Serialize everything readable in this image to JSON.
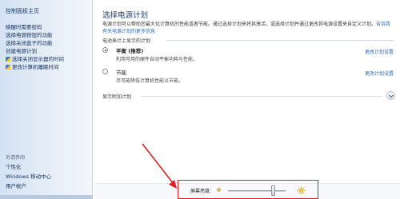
{
  "sidebar": {
    "home": "控制面板主页",
    "links": [
      "唤醒时需要密码",
      "选择电源按钮的功能",
      "选择关闭盖子的功能",
      "创建电源计划",
      "选择关闭显示器的时间",
      "更改计算机睡眠时间"
    ],
    "see_also_title": "另请参阅",
    "see_also": [
      "个性化",
      "Windows 移动中心",
      "用户帐户"
    ]
  },
  "main": {
    "title": "选择电源计划",
    "description": "电源计划可以帮助您最大化计算机的性能或者节能。通过选择计划来将其激活，或选择计划并通过更改其电源设置来自定义计划。",
    "description_link": "告诉我有关电源计划的更多信息",
    "section_label": "电池表计上显示的计划",
    "plans": [
      {
        "name": "平衡 (推荐)",
        "desc": "利用可用的硬件自动平衡功耗与性能。",
        "link": "更改计划设置",
        "selected": true
      },
      {
        "name": "节能",
        "desc": "尽可能降低计算机性能以节能。",
        "link": "更改计划设置",
        "selected": false
      }
    ],
    "show_more_label": "显示附加计划",
    "brightness_label": "屏幕亮度:",
    "brightness_level": 0.78
  },
  "icons": {
    "dim": "sun-dim-icon",
    "bright": "sun-bright-icon",
    "expand": "chevron-down-icon"
  },
  "colors": {
    "link": "#2a6cc5",
    "title": "#1e3f7a",
    "annotation": "#e02020"
  }
}
